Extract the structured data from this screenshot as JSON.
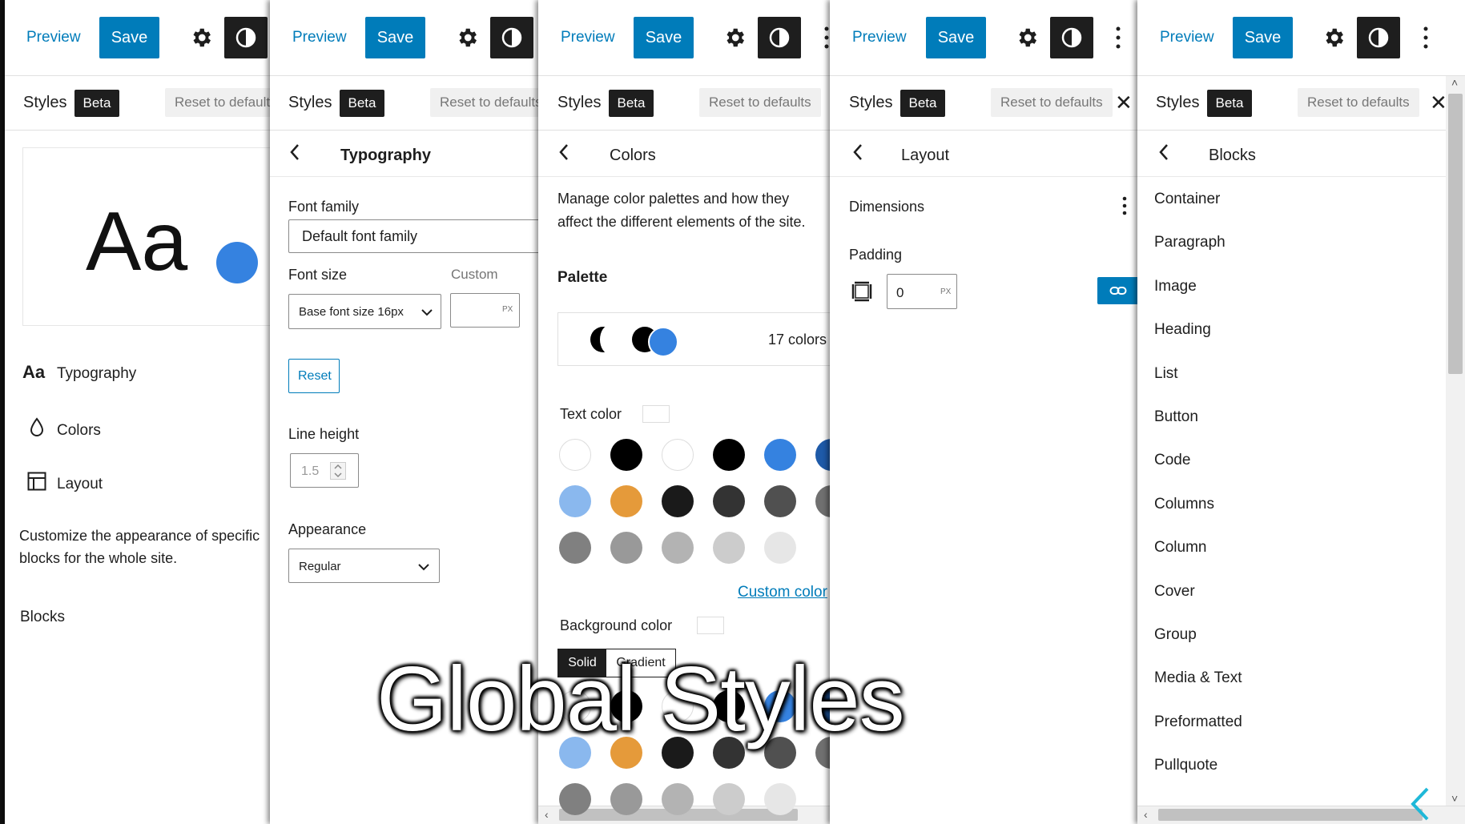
{
  "toolbar": {
    "preview": "Preview",
    "save": "Save"
  },
  "styles_bar": {
    "title": "Styles",
    "badge": "Beta",
    "reset": "Reset to defaults",
    "close": "✕"
  },
  "panel1": {
    "preview_text": "Aa",
    "nav": [
      {
        "icon_text": "Aa",
        "label": "Typography"
      },
      {
        "label": "Colors"
      },
      {
        "label": "Layout"
      }
    ],
    "description": "Customize the appearance of specific blocks for the whole site.",
    "blocks_label": "Blocks"
  },
  "panel2": {
    "title": "Typography",
    "font_family_label": "Font family",
    "font_family_value": "Default font family",
    "font_size_label": "Font size",
    "custom_label": "Custom",
    "font_size_value": "Base font size 16px",
    "unit": "PX",
    "reset": "Reset",
    "line_height_label": "Line height",
    "line_height_value": "1.5",
    "appearance_label": "Appearance",
    "appearance_value": "Regular"
  },
  "panel3": {
    "title": "Colors",
    "description_line1": "Manage color palettes and how they",
    "description_line2": "affect the different elements of the site.",
    "palette_label": "Palette",
    "colors_count": "17 colors",
    "text_color_label": "Text color",
    "custom_color": "Custom color",
    "background_color_label": "Background color",
    "tab_solid": "Solid",
    "tab_gradient": "Gradient",
    "swatches": [
      "#ffffff",
      "#000000",
      "#ffffff",
      "#000000",
      "#3582e0",
      "#1e5aa8",
      "#8ab8ee",
      "#e59a3a",
      "#1a1a1a",
      "#333333",
      "#505050",
      "#707070",
      "#808080",
      "#999999",
      "#b3b3b3",
      "#cccccc",
      "#e6e6e6"
    ]
  },
  "panel4": {
    "title": "Layout",
    "dimensions_label": "Dimensions",
    "padding_label": "Padding",
    "padding_value": "0",
    "unit": "PX"
  },
  "panel5": {
    "title": "Blocks",
    "blocks": [
      "Container",
      "Paragraph",
      "Image",
      "Heading",
      "List",
      "Button",
      "Code",
      "Columns",
      "Column",
      "Cover",
      "Group",
      "Media & Text",
      "Preformatted",
      "Pullquote"
    ]
  },
  "overlay_title": "Global Styles",
  "colors": {
    "accent": "#007cba",
    "dark": "#1e1e1e",
    "blue_dot": "#3582e0",
    "cyan_arrow": "#1fb8d8"
  }
}
